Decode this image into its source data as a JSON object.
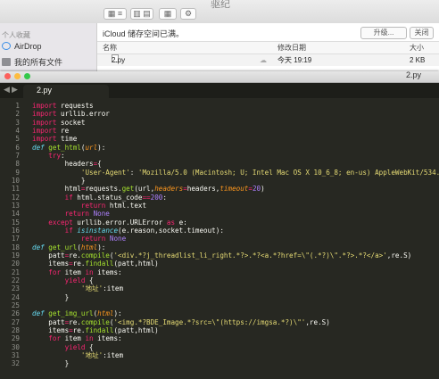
{
  "finder": {
    "title": "驱纪",
    "sidebar": {
      "favorites_label": "个人收藏",
      "items": [
        {
          "label": "AirDrop",
          "icon": "airdrop-icon"
        },
        {
          "label": "我的所有文件",
          "icon": "all-files-icon"
        }
      ]
    },
    "notice": "iCloud 储存空间已满。",
    "upgrade_label": "升级...",
    "close_label": "关闭",
    "columns": {
      "name": "名称",
      "date": "修改日期",
      "size": "大小"
    },
    "rows": [
      {
        "name": "2.py",
        "date": "今天 19:19",
        "size": "2 KB"
      }
    ]
  },
  "editor": {
    "window_title": "2.py",
    "nav_back": "◀",
    "nav_forward": "▶",
    "tab_label": "2.py",
    "lines": [
      {
        "n": "1",
        "html": "<span class=\"k\">import</span> requests"
      },
      {
        "n": "2",
        "html": "<span class=\"k\">import</span> urllib.error"
      },
      {
        "n": "3",
        "html": "<span class=\"k\">import</span> socket"
      },
      {
        "n": "4",
        "html": "<span class=\"k\">import</span> re"
      },
      {
        "n": "5",
        "html": "<span class=\"k\">import</span> time"
      },
      {
        "n": "6",
        "html": "<span class=\"d\">def</span> <span class=\"f\">get_html</span>(<span class=\"p\">url</span>):"
      },
      {
        "n": "7",
        "html": "    <span class=\"k\">try</span>:"
      },
      {
        "n": "8",
        "html": "        headers<span class=\"k\">=</span>{"
      },
      {
        "n": "9",
        "html": "            <span class=\"s\">'User-Agent'</span>: <span class=\"s\">'Mozilla/5.0 (Macintosh; U; Intel Mac OS X 10_6_8; en-us) AppleWebKit/534.</span>"
      },
      {
        "n": "10",
        "html": "            }"
      },
      {
        "n": "11",
        "html": "        html<span class=\"k\">=</span>requests.<span class=\"f\">get</span>(url,<span class=\"p\">headers</span><span class=\"k\">=</span>headers,<span class=\"p\">timeout</span><span class=\"k\">=</span><span class=\"n\">20</span>)"
      },
      {
        "n": "12",
        "html": "        <span class=\"k\">if</span> html.status_code<span class=\"k\">==</span><span class=\"n\">200</span>:"
      },
      {
        "n": "13",
        "html": "            <span class=\"k\">return</span> html.text"
      },
      {
        "n": "14",
        "html": "        <span class=\"k\">return</span> <span class=\"n\">None</span>"
      },
      {
        "n": "15",
        "html": "    <span class=\"k\">except</span> urllib.error.URLError <span class=\"k\">as</span> e:"
      },
      {
        "n": "16",
        "html": "        <span class=\"k\">if</span> <span class=\"d\">isinstance</span>(e.reason,socket.timeout):"
      },
      {
        "n": "17",
        "html": "            <span class=\"k\">return</span> <span class=\"n\">None</span>"
      },
      {
        "n": "18",
        "html": "<span class=\"d\">def</span> <span class=\"f\">get_url</span>(<span class=\"p\">html</span>):"
      },
      {
        "n": "19",
        "html": "    patt<span class=\"k\">=</span>re.<span class=\"f\">compile</span>(<span class=\"s\">'&lt;div.*?j_threadlist_li_right.*?&gt;.*?&lt;a.*?href=\\\"(.*?)\\\".*?&gt;.*?&lt;/a&gt;'</span>,re.S)"
      },
      {
        "n": "20",
        "html": "    items<span class=\"k\">=</span>re.<span class=\"f\">findall</span>(patt,html)"
      },
      {
        "n": "21",
        "html": "    <span class=\"k\">for</span> item <span class=\"k\">in</span> items:"
      },
      {
        "n": "22",
        "html": "        <span class=\"k\">yield</span> {"
      },
      {
        "n": "23",
        "html": "            <span class=\"s\">'地址'</span>:item"
      },
      {
        "n": "24",
        "html": "        }"
      },
      {
        "n": "25",
        "html": ""
      },
      {
        "n": "26",
        "html": "<span class=\"d\">def</span> <span class=\"f\">get_img_url</span>(<span class=\"p\">html</span>):"
      },
      {
        "n": "27",
        "html": "    patt<span class=\"k\">=</span>re.<span class=\"f\">compile</span>(<span class=\"s\">'&lt;img.*?BDE_Image.*?src=\\\"(https://imgsa.*?)\\\"'</span>,re.S)"
      },
      {
        "n": "28",
        "html": "    items<span class=\"k\">=</span>re.<span class=\"f\">findall</span>(patt,html)"
      },
      {
        "n": "29",
        "html": "    <span class=\"k\">for</span> item <span class=\"k\">in</span> items:"
      },
      {
        "n": "30",
        "html": "        <span class=\"k\">yield</span> {"
      },
      {
        "n": "31",
        "html": "            <span class=\"s\">'地址'</span>:item"
      },
      {
        "n": "32",
        "html": "        }"
      }
    ]
  },
  "colors": {
    "editor_bg": "#272822",
    "keyword": "#f92672",
    "string": "#e6db74",
    "function": "#a6e22e",
    "builtin": "#66d9ef",
    "param": "#fd971f",
    "number": "#ae81ff",
    "traffic_close": "#fc605c",
    "traffic_min": "#fdbc40",
    "traffic_max": "#34c84a"
  }
}
